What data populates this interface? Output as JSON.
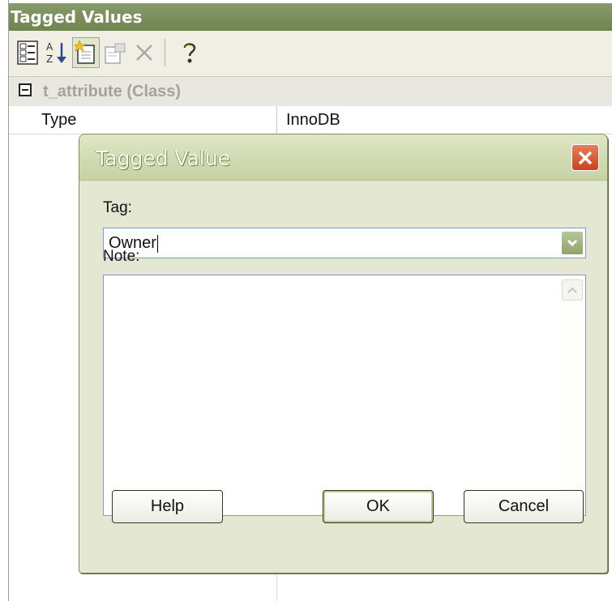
{
  "panel": {
    "title": "Tagged Values",
    "toolbar": [
      {
        "icon": "categorized-view-icon",
        "active": false
      },
      {
        "icon": "sort-alphabetical-icon",
        "active": false
      },
      {
        "icon": "new-tag-icon",
        "active": true
      },
      {
        "icon": "edit-tag-icon",
        "active": false
      },
      {
        "icon": "delete-icon",
        "active": false
      },
      {
        "icon": "help-icon",
        "active": false
      }
    ],
    "group": {
      "label": "t_attribute (Class)",
      "expander": "minus"
    },
    "properties": [
      {
        "name": "Type",
        "value": "InnoDB"
      }
    ]
  },
  "dialog": {
    "title": "Tagged Value",
    "tag_label": "Tag:",
    "tag_value": "Owner",
    "note_label": "Note:",
    "note_value": "",
    "buttons": {
      "help": "Help",
      "ok": "OK",
      "cancel": "Cancel"
    }
  },
  "colors": {
    "title_bar": "#6f844f",
    "dialog_bg": "#e4e8d3",
    "close_button": "#c9441e",
    "input_border": "#7f9db9"
  }
}
